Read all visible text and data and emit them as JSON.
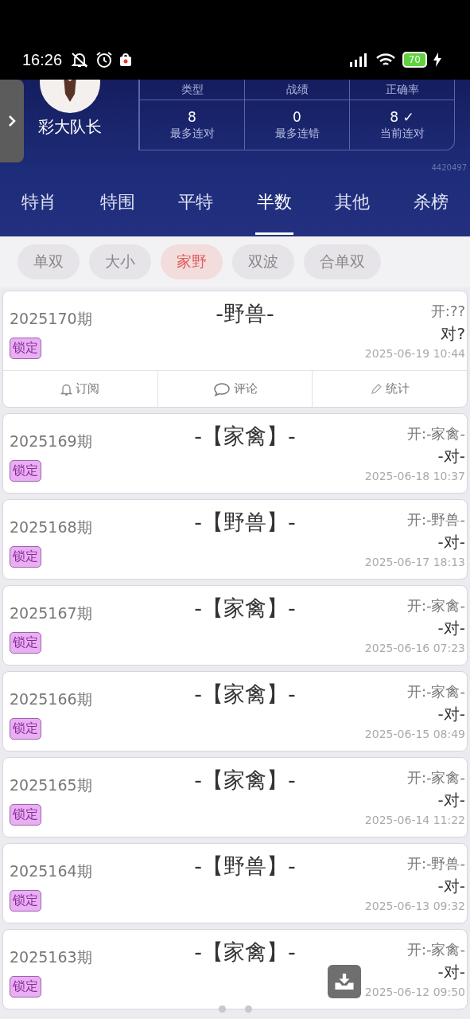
{
  "status_bar": {
    "time": "16:26",
    "battery": "70"
  },
  "profile": {
    "name": "彩大队长",
    "user_id": "4420497"
  },
  "stats": {
    "headers": [
      "类型",
      "战绩",
      "正确率"
    ],
    "cells": [
      {
        "value": "8",
        "label": "最多连对"
      },
      {
        "value": "0",
        "label": "最多连错"
      },
      {
        "value": "8 ✓",
        "label": "当前连对"
      }
    ]
  },
  "tabs": [
    {
      "label": "特肖",
      "selected": false
    },
    {
      "label": "特围",
      "selected": false
    },
    {
      "label": "平特",
      "selected": false
    },
    {
      "label": "半数",
      "selected": true
    },
    {
      "label": "其他",
      "selected": false
    },
    {
      "label": "杀榜",
      "selected": false
    }
  ],
  "chips": [
    {
      "label": "单双",
      "selected": false
    },
    {
      "label": "大小",
      "selected": false
    },
    {
      "label": "家野",
      "selected": true
    },
    {
      "label": "双波",
      "selected": false
    },
    {
      "label": "合单双",
      "selected": false
    }
  ],
  "records": [
    {
      "period": "2025170期",
      "badge": "锁定",
      "pick": "-野兽-",
      "open": "开:??",
      "result": "对?",
      "time": "2025-06-19 10:44",
      "actions": [
        "订阅",
        "评论",
        "统计"
      ]
    },
    {
      "period": "2025169期",
      "badge": "锁定",
      "pick": "-【家禽】-",
      "open": "开:-家禽-",
      "result": "-对-",
      "time": "2025-06-18 10:37"
    },
    {
      "period": "2025168期",
      "badge": "锁定",
      "pick": "-【野兽】-",
      "open": "开:-野兽-",
      "result": "-对-",
      "time": "2025-06-17 18:13"
    },
    {
      "period": "2025167期",
      "badge": "锁定",
      "pick": "-【家禽】-",
      "open": "开:-家禽-",
      "result": "-对-",
      "time": "2025-06-16 07:23"
    },
    {
      "period": "2025166期",
      "badge": "锁定",
      "pick": "-【家禽】-",
      "open": "开:-家禽-",
      "result": "-对-",
      "time": "2025-06-15 08:49"
    },
    {
      "period": "2025165期",
      "badge": "锁定",
      "pick": "-【家禽】-",
      "open": "开:-家禽-",
      "result": "-对-",
      "time": "2025-06-14 11:22"
    },
    {
      "period": "2025164期",
      "badge": "锁定",
      "pick": "-【野兽】-",
      "open": "开:-野兽-",
      "result": "-对-",
      "time": "2025-06-13 09:32"
    },
    {
      "period": "2025163期",
      "badge": "锁定",
      "pick": "-【家禽】-",
      "open": "开:-家禽-",
      "result": "-对-",
      "time": "2025-06-12 09:50"
    }
  ]
}
